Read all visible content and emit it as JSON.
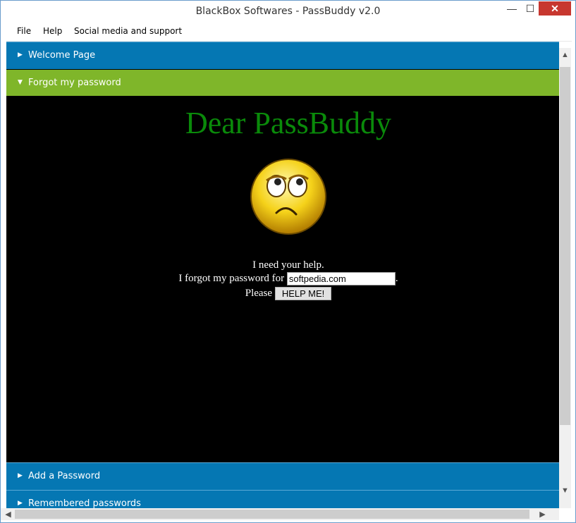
{
  "window": {
    "title": "BlackBox Softwares - PassBuddy v2.0",
    "minimize_icon": "—",
    "maximize_icon": "☐",
    "close_icon": "✕"
  },
  "menu": [
    "File",
    "Help",
    "Social media and support"
  ],
  "panels": {
    "welcome": {
      "label": "Welcome Page",
      "arrow": "▶"
    },
    "forgot": {
      "label": "Forgot my password",
      "arrow": "▼"
    },
    "add": {
      "label": "Add a Password",
      "arrow": "▶"
    },
    "remembered": {
      "label": "Remembered passwords",
      "arrow": "▶"
    }
  },
  "forgot_page": {
    "heading": "Dear PassBuddy",
    "line1": "I need your help.",
    "line2_prefix": "I forgot my password for",
    "line2_suffix": ".",
    "site_value": "softpedia.com",
    "line3_prefix": "Please",
    "help_button": "HELP ME!"
  },
  "colors": {
    "panel_blue": "#0577b3",
    "panel_green": "#7fb62a",
    "heading_green": "#0a8a0a"
  },
  "icons": {
    "scroll_up": "▲",
    "scroll_down": "▼",
    "scroll_left": "◀",
    "scroll_right": "▶"
  }
}
